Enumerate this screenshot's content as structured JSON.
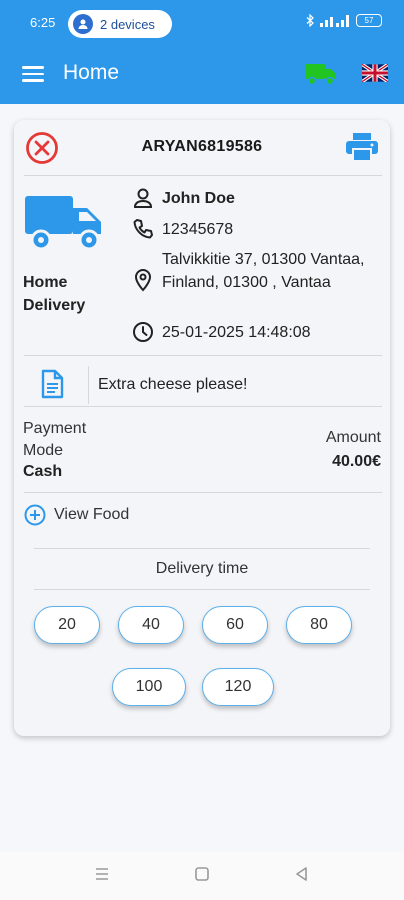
{
  "status": {
    "time": "6:25",
    "devices_label": "2 devices",
    "battery": "57"
  },
  "appbar": {
    "title": "Home",
    "menu_icon": "menu-icon",
    "truck_icon": "truck-icon",
    "truck_color": "#22c422",
    "language_flag": "uk-flag-icon"
  },
  "order": {
    "id": "ARYAN6819586",
    "delivery_type": "Home Delivery",
    "customer_name": "John Doe",
    "phone": "12345678",
    "address": "Talvikkitie 37, 01300 Vantaa, Finland, 01300 , Vantaa",
    "datetime": "25-01-2025 14:48:08",
    "note": "Extra cheese please!",
    "payment_label": "Payment Mode",
    "payment_value": "Cash",
    "amount_label": "Amount",
    "amount_value": "40.00€",
    "view_food_label": "View Food"
  },
  "delivery_time": {
    "label": "Delivery time",
    "options": [
      "20",
      "40",
      "60",
      "80",
      "100",
      "120"
    ]
  },
  "colors": {
    "primary": "#2d98ea",
    "cancel_red": "#e53935",
    "button_border": "#5db0ea"
  }
}
